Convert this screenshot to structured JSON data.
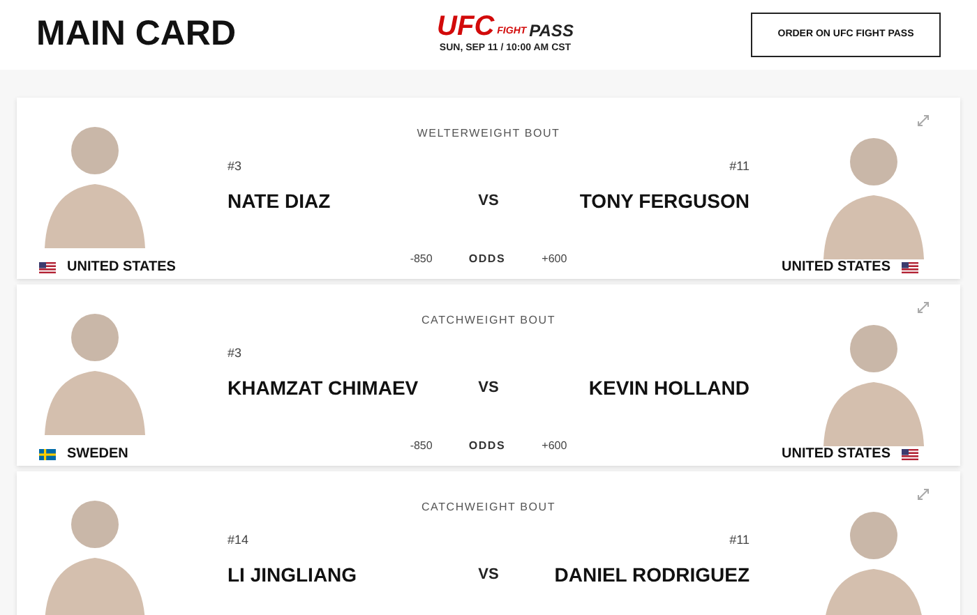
{
  "header": {
    "title": "MAIN CARD",
    "logo": {
      "brand": "UFC",
      "sub_top": "FIGHT",
      "sub_main": "PASS"
    },
    "date": "SUN, SEP 11 / 10:00 AM CST",
    "order_button": "ORDER ON UFC FIGHT PASS"
  },
  "bouts": [
    {
      "weight_class": "WELTERWEIGHT BOUT",
      "vs": "VS",
      "odds_label": "ODDS",
      "red": {
        "rank": "#3",
        "name": "NATE DIAZ",
        "country": "UNITED STATES",
        "flag": {
          "kind": "us"
        },
        "odds": "-850"
      },
      "blue": {
        "rank": "#11",
        "name": "TONY FERGUSON",
        "country": "UNITED STATES",
        "flag": {
          "kind": "us"
        },
        "odds": "+600"
      }
    },
    {
      "weight_class": "CATCHWEIGHT BOUT",
      "vs": "VS",
      "odds_label": "ODDS",
      "red": {
        "rank": "#3",
        "name": "KHAMZAT CHIMAEV",
        "country": "SWEDEN",
        "flag": {
          "kind": "se"
        },
        "odds": "-850"
      },
      "blue": {
        "name": "KEVIN HOLLAND",
        "country": "UNITED STATES",
        "flag": {
          "kind": "us"
        },
        "odds": "+600"
      }
    },
    {
      "weight_class": "CATCHWEIGHT BOUT",
      "vs": "VS",
      "red": {
        "rank": "#14",
        "name": "LI JINGLIANG"
      },
      "blue": {
        "rank": "#11",
        "name": "DANIEL RODRIGUEZ"
      }
    }
  ]
}
